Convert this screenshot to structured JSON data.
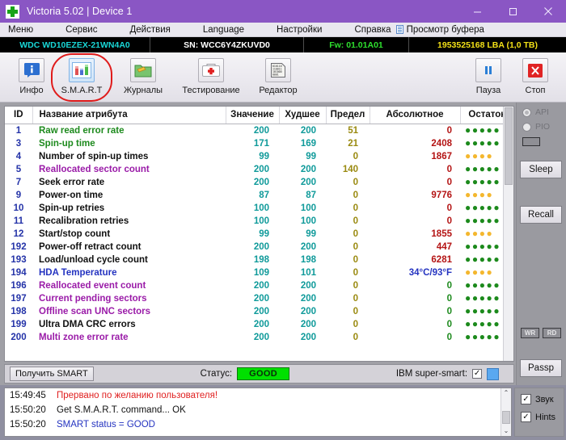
{
  "window": {
    "title": "Victoria 5.02 | Device 1",
    "logo_icon": "green-cross-icon",
    "minimize_label": "—",
    "maximize_label": "□",
    "close_label": "✕"
  },
  "menubar": {
    "items": [
      {
        "label": "Меню"
      },
      {
        "label": "Сервис"
      },
      {
        "label": "Действия"
      },
      {
        "label": "Language"
      },
      {
        "label": "Настройки"
      },
      {
        "label": "Справка"
      }
    ],
    "buffer_view_label": "Просмотр буфера",
    "buffer_icon": "buffer-list-icon"
  },
  "drivebar": {
    "model": "WDC WD10EZEX-21WN4A0",
    "serial": "SN: WCC6Y4ZKUVD0",
    "firmware": "Fw: 01.01A01",
    "capacity": "1953525168 LBA (1,0 TB)",
    "model_color": "#19d7d7",
    "fw_color": "#2ee02e",
    "capacity_color": "#f2e017"
  },
  "toolbar": {
    "buttons": [
      {
        "label": "Инфо",
        "icon": "info-icon",
        "selected": false
      },
      {
        "label": "S.M.A.R.T",
        "icon": "smart-chart-icon",
        "selected": true
      },
      {
        "label": "Журналы",
        "icon": "folder-pencil-icon",
        "selected": false
      },
      {
        "label": "Тестирование",
        "icon": "first-aid-icon",
        "selected": false
      },
      {
        "label": "Редактор",
        "icon": "hex-editor-icon",
        "selected": false
      }
    ],
    "right_buttons": [
      {
        "label": "Пауза",
        "icon": "pause-icon"
      },
      {
        "label": "Стоп",
        "icon": "stop-x-icon"
      }
    ],
    "highlight_color": "#e01b1b"
  },
  "smart_table": {
    "headers": [
      "ID",
      "Название атрибута",
      "Значение",
      "Худшее",
      "Предел",
      "Абсолютное",
      "Остаток"
    ],
    "rows": [
      {
        "id": "1",
        "name": "Raw read error rate",
        "name_color": "green",
        "value": "200",
        "worst": "200",
        "limit": "51",
        "abs": "0",
        "abs_color": "zero",
        "dots": 5,
        "dots_color": "g"
      },
      {
        "id": "3",
        "name": "Spin-up time",
        "name_color": "green",
        "value": "171",
        "worst": "169",
        "limit": "21",
        "abs": "2408",
        "abs_color": "val",
        "dots": 5,
        "dots_color": "g"
      },
      {
        "id": "4",
        "name": "Number of spin-up times",
        "name_color": "black",
        "value": "99",
        "worst": "99",
        "limit": "0",
        "abs": "1867",
        "abs_color": "val",
        "dots": 4,
        "dots_color": "y"
      },
      {
        "id": "5",
        "name": "Reallocated sector count",
        "name_color": "purple",
        "value": "200",
        "worst": "200",
        "limit": "140",
        "abs": "0",
        "abs_color": "zero",
        "dots": 5,
        "dots_color": "g"
      },
      {
        "id": "7",
        "name": "Seek error rate",
        "name_color": "black",
        "value": "200",
        "worst": "200",
        "limit": "0",
        "abs": "0",
        "abs_color": "zero",
        "dots": 5,
        "dots_color": "g"
      },
      {
        "id": "9",
        "name": "Power-on time",
        "name_color": "black",
        "value": "87",
        "worst": "87",
        "limit": "0",
        "abs": "9776",
        "abs_color": "val",
        "dots": 4,
        "dots_color": "y"
      },
      {
        "id": "10",
        "name": "Spin-up retries",
        "name_color": "black",
        "value": "100",
        "worst": "100",
        "limit": "0",
        "abs": "0",
        "abs_color": "zero",
        "dots": 5,
        "dots_color": "g"
      },
      {
        "id": "11",
        "name": "Recalibration retries",
        "name_color": "black",
        "value": "100",
        "worst": "100",
        "limit": "0",
        "abs": "0",
        "abs_color": "zero",
        "dots": 5,
        "dots_color": "g"
      },
      {
        "id": "12",
        "name": "Start/stop count",
        "name_color": "black",
        "value": "99",
        "worst": "99",
        "limit": "0",
        "abs": "1855",
        "abs_color": "val",
        "dots": 4,
        "dots_color": "y"
      },
      {
        "id": "192",
        "name": "Power-off retract count",
        "name_color": "black",
        "value": "200",
        "worst": "200",
        "limit": "0",
        "abs": "447",
        "abs_color": "val",
        "dots": 5,
        "dots_color": "g"
      },
      {
        "id": "193",
        "name": "Load/unload cycle count",
        "name_color": "black",
        "value": "198",
        "worst": "198",
        "limit": "0",
        "abs": "6281",
        "abs_color": "val",
        "dots": 5,
        "dots_color": "g"
      },
      {
        "id": "194",
        "name": "HDA Temperature",
        "name_color": "blue",
        "value": "109",
        "worst": "101",
        "limit": "0",
        "abs": "34°C/93°F",
        "abs_color": "temp",
        "dots": 4,
        "dots_color": "y"
      },
      {
        "id": "196",
        "name": "Reallocated event count",
        "name_color": "purple",
        "value": "200",
        "worst": "200",
        "limit": "0",
        "abs": "0",
        "abs_color": "green",
        "dots": 5,
        "dots_color": "g"
      },
      {
        "id": "197",
        "name": "Current pending sectors",
        "name_color": "purple",
        "value": "200",
        "worst": "200",
        "limit": "0",
        "abs": "0",
        "abs_color": "green",
        "dots": 5,
        "dots_color": "g"
      },
      {
        "id": "198",
        "name": "Offline scan UNC sectors",
        "name_color": "purple",
        "value": "200",
        "worst": "200",
        "limit": "0",
        "abs": "0",
        "abs_color": "green",
        "dots": 5,
        "dots_color": "g"
      },
      {
        "id": "199",
        "name": "Ultra DMA CRC errors",
        "name_color": "black",
        "value": "200",
        "worst": "200",
        "limit": "0",
        "abs": "0",
        "abs_color": "green",
        "dots": 5,
        "dots_color": "g"
      },
      {
        "id": "200",
        "name": "Multi zone error rate",
        "name_color": "purple",
        "value": "200",
        "worst": "200",
        "limit": "0",
        "abs": "0",
        "abs_color": "green",
        "dots": 5,
        "dots_color": "g"
      }
    ]
  },
  "smart_bottom": {
    "get_smart_label": "Получить SMART",
    "status_label": "Статус:",
    "status_value": "GOOD",
    "status_color": "#00e000",
    "ibm_label": "IBM super-smart:",
    "ibm_checked": "✓",
    "indicator_color": "#5aa8f0"
  },
  "sidepanel": {
    "radios": [
      {
        "label": "API",
        "checked": true
      },
      {
        "label": "PIO",
        "checked": false
      }
    ],
    "buttons": [
      {
        "label": "Sleep"
      },
      {
        "label": "Recall"
      },
      {
        "label": "Passp"
      }
    ],
    "mini_buttons": [
      {
        "label": "WR"
      },
      {
        "label": "RD"
      }
    ]
  },
  "log": {
    "lines": [
      {
        "time": "15:49:45",
        "message": "Прервано по желанию пользователя!",
        "color": "red"
      },
      {
        "time": "15:50:20",
        "message": "Get S.M.A.R.T. command... OK",
        "color": "black"
      },
      {
        "time": "15:50:20",
        "message": "SMART status = GOOD",
        "color": "blue"
      }
    ],
    "scroll_up": "⌃",
    "scroll_down": "⌄"
  },
  "log_options": {
    "items": [
      {
        "label": "Звук",
        "checked": "✓"
      },
      {
        "label": "Hints",
        "checked": "✓"
      }
    ]
  }
}
